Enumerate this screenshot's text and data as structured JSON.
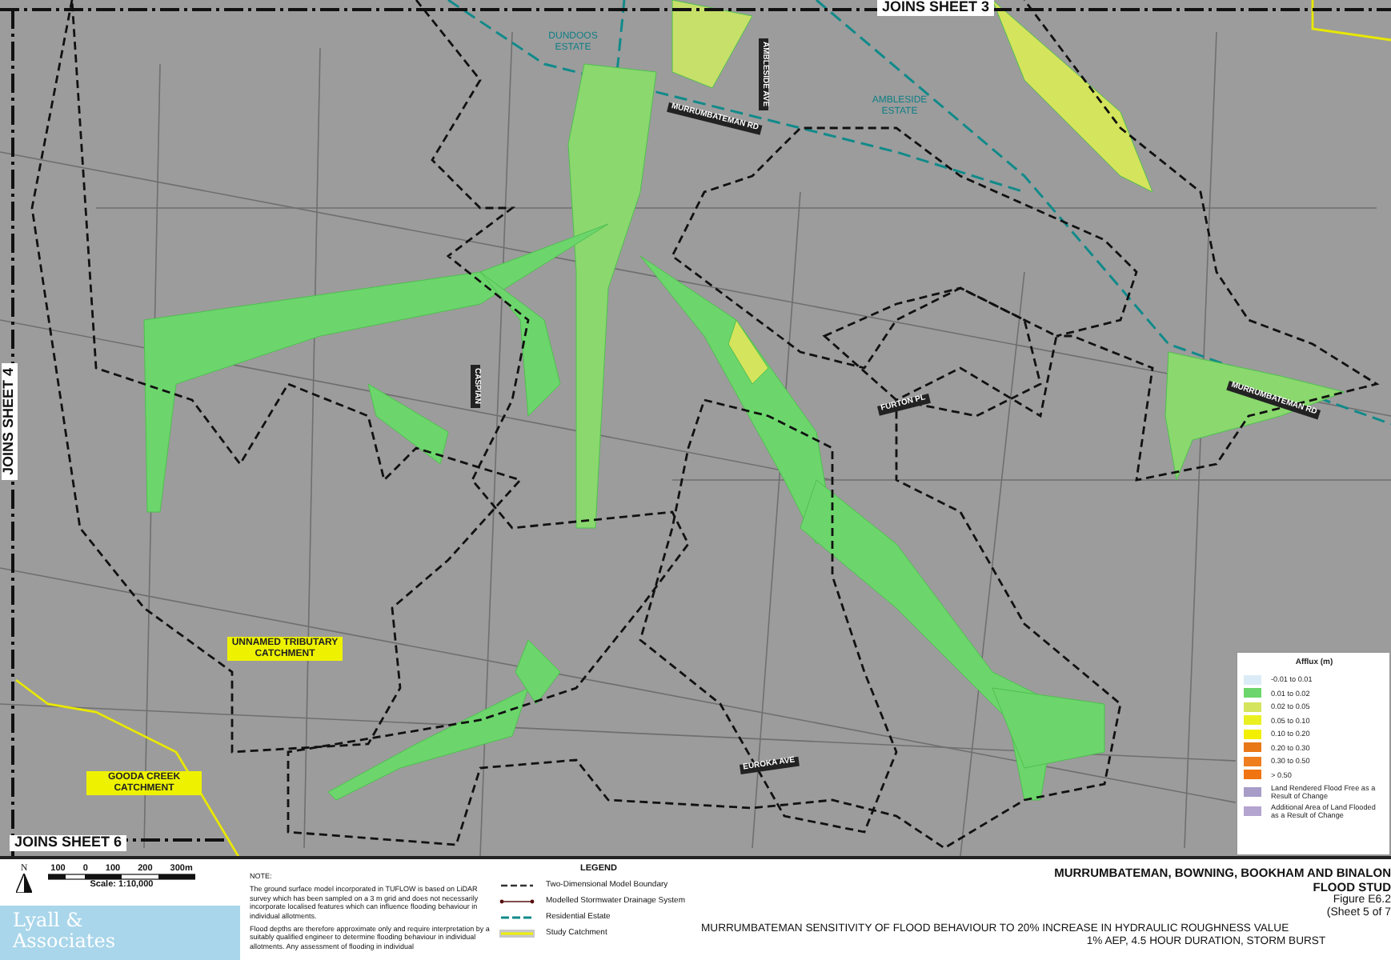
{
  "map": {
    "labels": [
      {
        "text": "JOINS SHEET 3",
        "kind": "sheet"
      },
      {
        "text": "DUNDOOS ESTATE",
        "kind": "estate"
      },
      {
        "text": "AMBLESIDE ESTATE",
        "kind": "estate"
      },
      {
        "text": "MURRUMBATEMAN RD",
        "kind": "road"
      },
      {
        "text": "AMBLESIDE AVE",
        "kind": "road"
      },
      {
        "text": "CASPIAN",
        "kind": "road"
      },
      {
        "text": "FURTON PL",
        "kind": "road"
      },
      {
        "text": "MURRUMBATEMAN RD",
        "kind": "road"
      },
      {
        "text": "JOINS SHEET 4",
        "kind": "sheet"
      },
      {
        "text": "UNNAMED TRIBUTARY CATCHMENT",
        "kind": "catchment"
      },
      {
        "text": "GOODA CREEK CATCHMENT",
        "kind": "catchment"
      },
      {
        "text": "EUROKA AVE",
        "kind": "road"
      },
      {
        "text": "JOINS SHEET 6",
        "kind": "sheet"
      }
    ],
    "afflux_legend": {
      "title": "Afflux (m)",
      "items": [
        {
          "label": "-0.01 to 0.01",
          "color": "#dcecf7"
        },
        {
          "label": "0.01 to 0.02",
          "color": "#6cd66c"
        },
        {
          "label": "0.02 to 0.05",
          "color": "#d4e45c"
        },
        {
          "label": "0.05 to 0.10",
          "color": "#eaf020"
        },
        {
          "label": "0.10 to 0.20",
          "color": "#f2f000"
        },
        {
          "label": "0.20 to 0.30",
          "color": "#e87818"
        },
        {
          "label": "0.30 to 0.50",
          "color": "#ee7e1e"
        },
        {
          "label": "> 0.50",
          "color": "#f07410"
        },
        {
          "label": "Land Rendered Flood Free as a Result of Change",
          "color": "#a89cc8"
        },
        {
          "label": "Additional Area of Land Flooded as a Result of Change",
          "color": "#b4a4d0"
        }
      ]
    }
  },
  "footer": {
    "north": "N",
    "scale_ticks": [
      "100",
      "0",
      "100",
      "200",
      "300m"
    ],
    "scale": "Scale: 1:10,000",
    "logo": [
      "Lyall &",
      "Associates"
    ],
    "note_heading": "NOTE:",
    "notes": [
      "The ground surface model incorporated in TUFLOW is based on LiDAR survey which has been sampled on a 3 m grid and does not necessarily incorporate localised features which can influence flooding behaviour in individual allotments.",
      "Flood depths are therefore approximate only and require interpretation by a suitably qualified engineer to determine flooding behaviour in individual allotments. Any assessment of flooding in individual"
    ],
    "legend_title": "LEGEND",
    "legend": [
      {
        "label": "Two-Dimensional Model Boundary",
        "kind": "boundary"
      },
      {
        "label": "Modelled Stormwater Drainage System",
        "kind": "drainage"
      },
      {
        "label": "Residential Estate",
        "kind": "estate"
      },
      {
        "label": "Study Catchment",
        "kind": "catchment"
      }
    ],
    "title": "MURRUMBATEMAN, BOWNING, BOOKHAM AND BINALON",
    "subtitle": "FLOOD STUD",
    "figure": "Figure E6.2",
    "sheet": "(Sheet 5 of 7",
    "caption": "MURRUMBATEMAN SENSITIVITY OF FLOOD BEHAVIOUR TO 20% INCREASE IN HYDRAULIC ROUGHNESS VALUE",
    "caption_2": "1% AEP, 4.5 HOUR DURATION, STORM BURST"
  }
}
